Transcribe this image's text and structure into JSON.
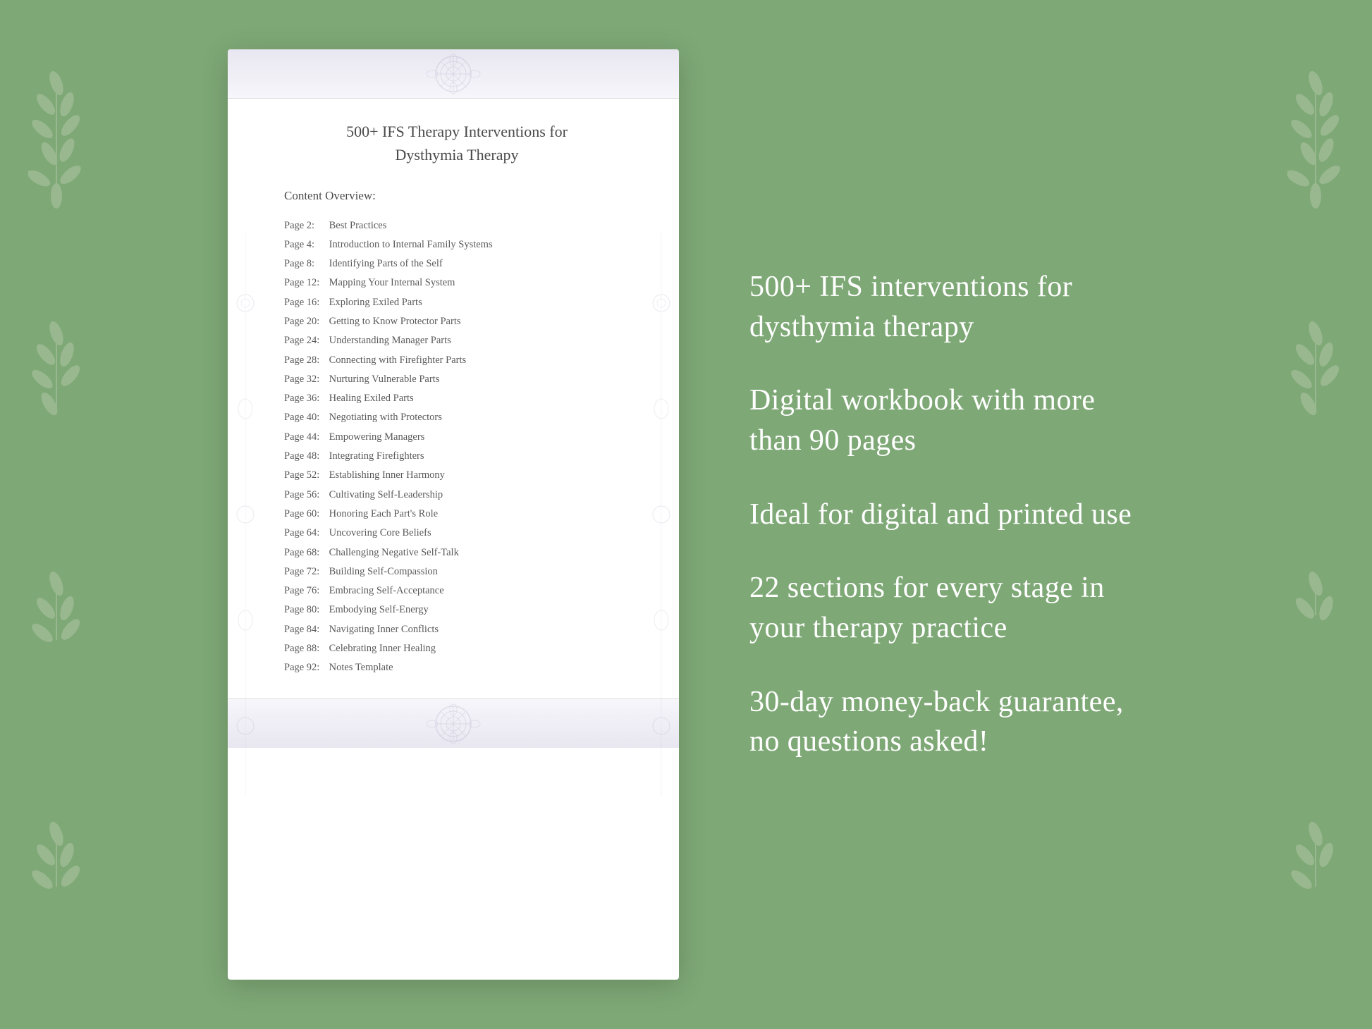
{
  "background": {
    "color": "#7ea876"
  },
  "document": {
    "title_line1": "500+ IFS Therapy Interventions for",
    "title_line2": "Dysthymia Therapy",
    "section_heading": "Content Overview:",
    "toc": [
      {
        "page": "Page  2:",
        "title": "Best Practices"
      },
      {
        "page": "Page  4:",
        "title": "Introduction to Internal Family Systems"
      },
      {
        "page": "Page  8:",
        "title": "Identifying Parts of the Self"
      },
      {
        "page": "Page 12:",
        "title": "Mapping Your Internal System"
      },
      {
        "page": "Page 16:",
        "title": "Exploring Exiled Parts"
      },
      {
        "page": "Page 20:",
        "title": "Getting to Know Protector Parts"
      },
      {
        "page": "Page 24:",
        "title": "Understanding Manager Parts"
      },
      {
        "page": "Page 28:",
        "title": "Connecting with Firefighter Parts"
      },
      {
        "page": "Page 32:",
        "title": "Nurturing Vulnerable Parts"
      },
      {
        "page": "Page 36:",
        "title": "Healing Exiled Parts"
      },
      {
        "page": "Page 40:",
        "title": "Negotiating with Protectors"
      },
      {
        "page": "Page 44:",
        "title": "Empowering Managers"
      },
      {
        "page": "Page 48:",
        "title": "Integrating Firefighters"
      },
      {
        "page": "Page 52:",
        "title": "Establishing Inner Harmony"
      },
      {
        "page": "Page 56:",
        "title": "Cultivating Self-Leadership"
      },
      {
        "page": "Page 60:",
        "title": "Honoring Each Part's Role"
      },
      {
        "page": "Page 64:",
        "title": "Uncovering Core Beliefs"
      },
      {
        "page": "Page 68:",
        "title": "Challenging Negative Self-Talk"
      },
      {
        "page": "Page 72:",
        "title": "Building Self-Compassion"
      },
      {
        "page": "Page 76:",
        "title": "Embracing Self-Acceptance"
      },
      {
        "page": "Page 80:",
        "title": "Embodying Self-Energy"
      },
      {
        "page": "Page 84:",
        "title": "Navigating Inner Conflicts"
      },
      {
        "page": "Page 88:",
        "title": "Celebrating Inner Healing"
      },
      {
        "page": "Page 92:",
        "title": "Notes Template"
      }
    ]
  },
  "features": [
    "500+ IFS interventions for dysthymia therapy",
    "Digital workbook with more than 90 pages",
    "Ideal for digital and printed use",
    "22 sections for every stage in your therapy practice",
    "30-day money-back guarantee, no questions asked!"
  ]
}
